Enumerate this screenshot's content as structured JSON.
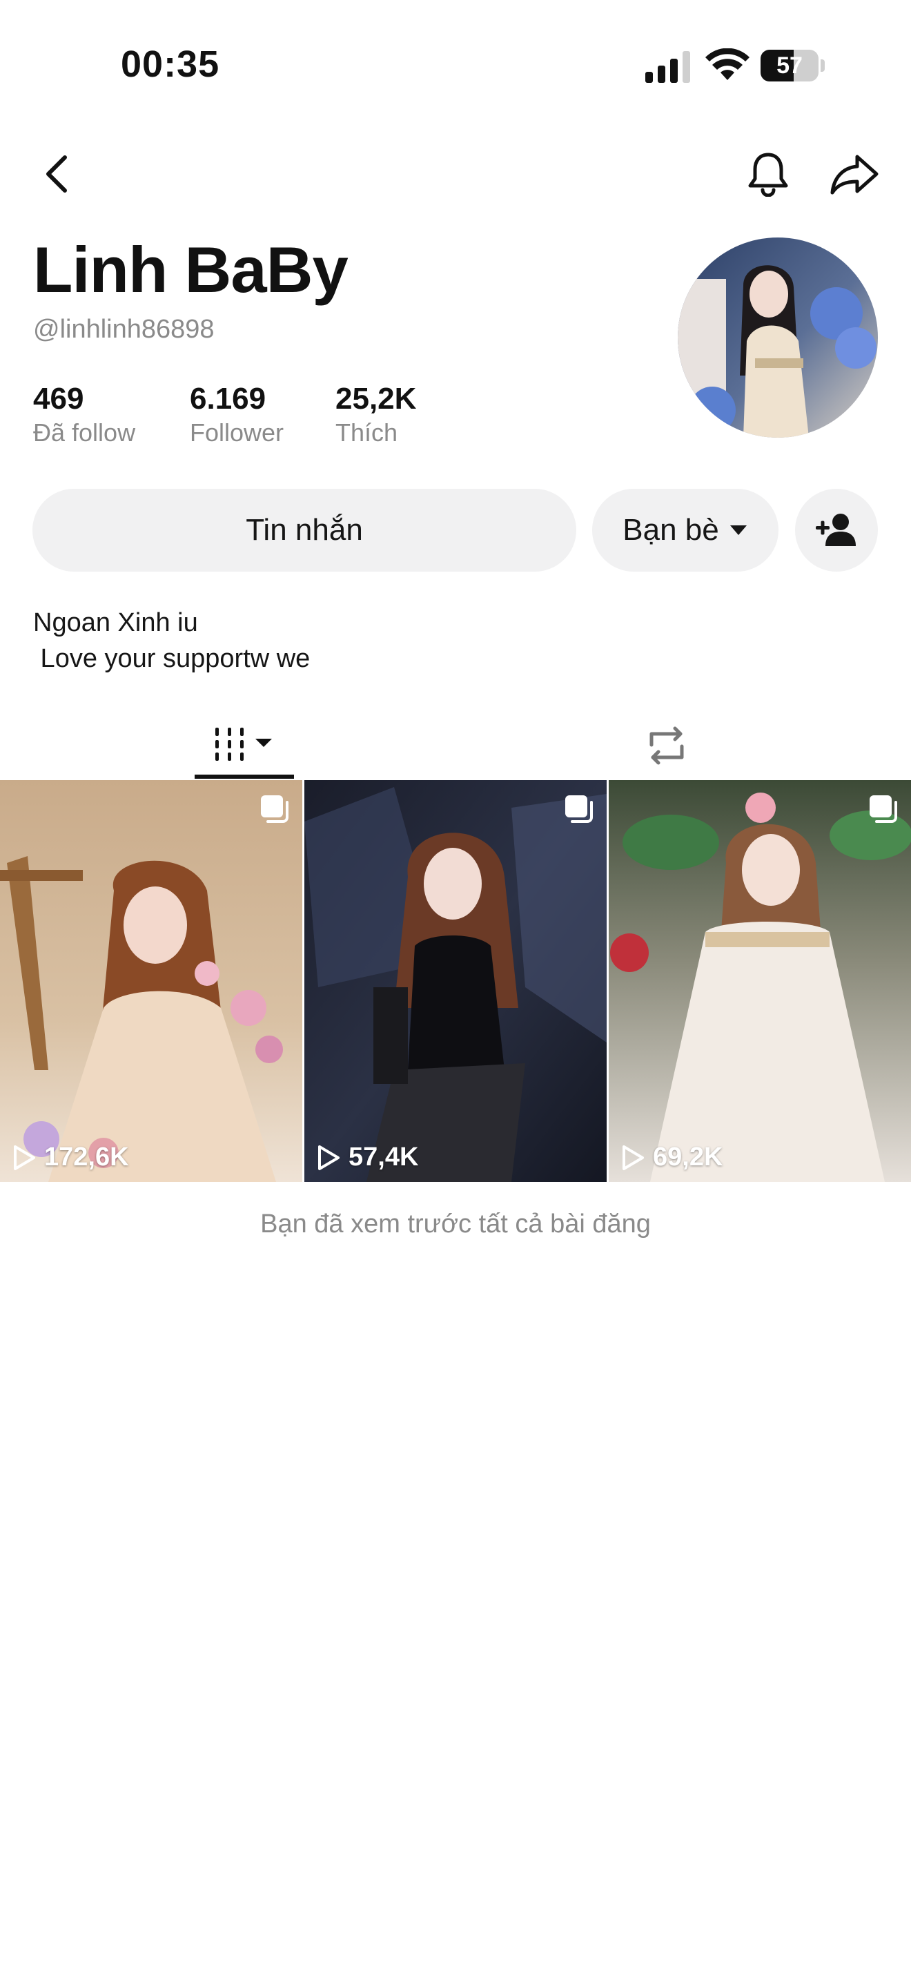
{
  "status_bar": {
    "time": "00:35",
    "battery": "57",
    "battery_level": 0.57
  },
  "icons": {
    "back": "chevron-left-icon",
    "bell": "bell-icon",
    "share": "share-arrow-icon",
    "add_friend": "person-plus-icon",
    "videos_tab": "grid-columns-icon",
    "reposts_tab": "repost-icon",
    "multi": "multi-photo-icon",
    "play": "play-icon"
  },
  "profile": {
    "display_name": "Linh BaBy",
    "username": "@linhlinh86898",
    "stats": [
      {
        "value": "469",
        "label": "Đã follow"
      },
      {
        "value": "6.169",
        "label": "Follower"
      },
      {
        "value": "25,2K",
        "label": "Thích"
      }
    ],
    "bio": "Ngoan Xinh iu\n Love your supportw we"
  },
  "actions": {
    "message_label": "Tin nhắn",
    "friends_label": "Bạn bè"
  },
  "posts": [
    {
      "views": "172,6K"
    },
    {
      "views": "57,4K"
    },
    {
      "views": "69,2K"
    }
  ],
  "footer_note": "Bạn đã xem trước tất cả bài đăng",
  "colors": {
    "text": "#111111",
    "secondary": "#8a8a8a",
    "button_bg": "#f1f1f2"
  }
}
